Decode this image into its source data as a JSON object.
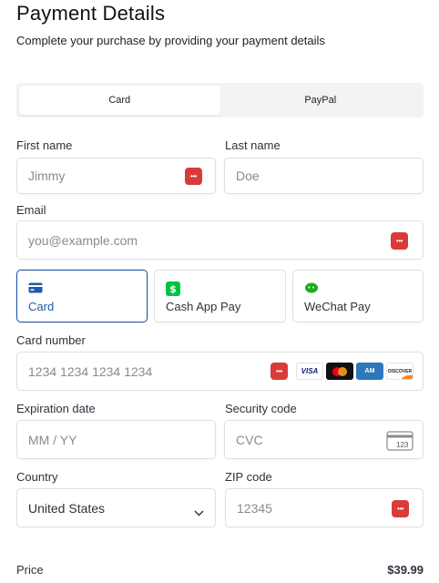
{
  "header": {
    "title": "Payment Details",
    "subtitle": "Complete your purchase by providing your payment details"
  },
  "tabs": [
    {
      "label": "Card",
      "active": true
    },
    {
      "label": "PayPal",
      "active": false
    }
  ],
  "form": {
    "first_name": {
      "label": "First name",
      "placeholder": "Jimmy"
    },
    "last_name": {
      "label": "Last name",
      "placeholder": "Doe"
    },
    "email": {
      "label": "Email",
      "placeholder": "you@example.com"
    },
    "payment_methods": [
      {
        "label": "Card",
        "icon": "card-icon",
        "active": true
      },
      {
        "label": "Cash App Pay",
        "icon": "cash-app-icon",
        "active": false
      },
      {
        "label": "WeChat Pay",
        "icon": "wechat-icon",
        "active": false
      }
    ],
    "card_number": {
      "label": "Card number",
      "placeholder": "1234 1234 1234 1234"
    },
    "card_brands": [
      {
        "name": "visa",
        "text": "VISA"
      },
      {
        "name": "mastercard",
        "text": ""
      },
      {
        "name": "amex",
        "text": "AM"
      },
      {
        "name": "discover",
        "text": "DISCOVER"
      }
    ],
    "expiration": {
      "label": "Expiration date",
      "placeholder": "MM / YY"
    },
    "security_code": {
      "label": "Security code",
      "placeholder": "CVC",
      "icon_text": "123"
    },
    "country": {
      "label": "Country",
      "value": "United States"
    },
    "zip": {
      "label": "ZIP code",
      "placeholder": "12345"
    }
  },
  "summary": {
    "price_label": "Price",
    "price_value": "$39.99"
  },
  "colors": {
    "accent": "#1f5aa6",
    "autofill": "#d93b3b",
    "cashapp": "#00c244",
    "wechat": "#1aad19"
  }
}
